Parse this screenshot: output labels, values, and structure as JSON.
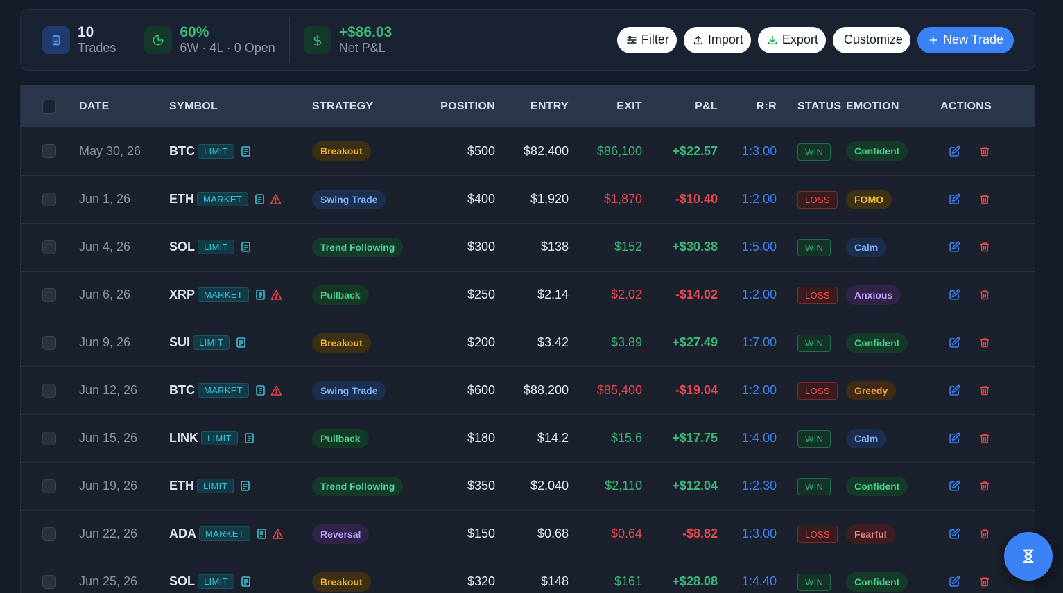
{
  "summary": {
    "trades_value": "10",
    "trades_label": "Trades",
    "winrate_value": "60%",
    "winrate_label": "6W · 4L · 0 Open",
    "pnl_value": "+$86.03",
    "pnl_label": "Net P&L"
  },
  "toolbar": {
    "filter_label": "Filter",
    "import_label": "Import",
    "export_label": "Export",
    "customize_label": "Customize",
    "new_trade_label": "New Trade"
  },
  "colors": {
    "accent": "#3b82f6",
    "profit": "#3ab97a",
    "loss": "#e5484d",
    "background": "#151b27",
    "header_row": "#2a3649"
  },
  "table": {
    "headers": [
      "DATE",
      "SYMBOL",
      "STRATEGY",
      "POSITION",
      "ENTRY",
      "EXIT",
      "P&L",
      "R:R",
      "STATUS",
      "EMOTION",
      "ACTIONS"
    ],
    "rows": [
      {
        "date": "May 30, 26",
        "symbol": "BTC",
        "order_type": "LIMIT",
        "warning": false,
        "strategy": "Breakout",
        "position": "$500",
        "entry": "$82,400",
        "exit": "$86,100",
        "pnl": "+$22.57",
        "rr": "1:3.00",
        "status": "WIN",
        "emotion": "Confident"
      },
      {
        "date": "Jun 1, 26",
        "symbol": "ETH",
        "order_type": "MARKET",
        "warning": true,
        "strategy": "Swing Trade",
        "position": "$400",
        "entry": "$1,920",
        "exit": "$1,870",
        "pnl": "-$10.40",
        "rr": "1:2.00",
        "status": "LOSS",
        "emotion": "FOMO"
      },
      {
        "date": "Jun 4, 26",
        "symbol": "SOL",
        "order_type": "LIMIT",
        "warning": false,
        "strategy": "Trend Following",
        "position": "$300",
        "entry": "$138",
        "exit": "$152",
        "pnl": "+$30.38",
        "rr": "1:5.00",
        "status": "WIN",
        "emotion": "Calm"
      },
      {
        "date": "Jun 6, 26",
        "symbol": "XRP",
        "order_type": "MARKET",
        "warning": true,
        "strategy": "Pullback",
        "position": "$250",
        "entry": "$2.14",
        "exit": "$2.02",
        "pnl": "-$14.02",
        "rr": "1:2.00",
        "status": "LOSS",
        "emotion": "Anxious"
      },
      {
        "date": "Jun 9, 26",
        "symbol": "SUI",
        "order_type": "LIMIT",
        "warning": false,
        "strategy": "Breakout",
        "position": "$200",
        "entry": "$3.42",
        "exit": "$3.89",
        "pnl": "+$27.49",
        "rr": "1:7.00",
        "status": "WIN",
        "emotion": "Confident"
      },
      {
        "date": "Jun 12, 26",
        "symbol": "BTC",
        "order_type": "MARKET",
        "warning": true,
        "strategy": "Swing Trade",
        "position": "$600",
        "entry": "$88,200",
        "exit": "$85,400",
        "pnl": "-$19.04",
        "rr": "1:2.00",
        "status": "LOSS",
        "emotion": "Greedy"
      },
      {
        "date": "Jun 15, 26",
        "symbol": "LINK",
        "order_type": "LIMIT",
        "warning": false,
        "strategy": "Pullback",
        "position": "$180",
        "entry": "$14.2",
        "exit": "$15.6",
        "pnl": "+$17.75",
        "rr": "1:4.00",
        "status": "WIN",
        "emotion": "Calm"
      },
      {
        "date": "Jun 19, 26",
        "symbol": "ETH",
        "order_type": "LIMIT",
        "warning": false,
        "strategy": "Trend Following",
        "position": "$350",
        "entry": "$2,040",
        "exit": "$2,110",
        "pnl": "+$12.04",
        "rr": "1:2.30",
        "status": "WIN",
        "emotion": "Confident"
      },
      {
        "date": "Jun 22, 26",
        "symbol": "ADA",
        "order_type": "MARKET",
        "warning": true,
        "strategy": "Reversal",
        "position": "$150",
        "entry": "$0.68",
        "exit": "$0.64",
        "pnl": "-$8.82",
        "rr": "1:3.00",
        "status": "LOSS",
        "emotion": "Fearful"
      },
      {
        "date": "Jun 25, 26",
        "symbol": "SOL",
        "order_type": "LIMIT",
        "warning": false,
        "strategy": "Breakout",
        "position": "$320",
        "entry": "$148",
        "exit": "$161",
        "pnl": "+$28.08",
        "rr": "1:4.40",
        "status": "WIN",
        "emotion": "Confident"
      }
    ]
  },
  "strategy_colors": {
    "Breakout": {
      "bg": "#3d2f14",
      "fg": "#f2b233"
    },
    "Swing Trade": {
      "bg": "#1c2f4d",
      "fg": "#7fb0ff"
    },
    "Trend Following": {
      "bg": "#153a2c",
      "fg": "#4fd39a"
    },
    "Pullback": {
      "bg": "#143826",
      "fg": "#4ccf8a"
    },
    "Reversal": {
      "bg": "#2f2347",
      "fg": "#b99aff"
    }
  },
  "emotion_colors": {
    "Confident": {
      "bg": "#153a2a",
      "fg": "#45d08a"
    },
    "FOMO": {
      "bg": "#3f3214",
      "fg": "#f3bf2f"
    },
    "Calm": {
      "bg": "#1b2e4b",
      "fg": "#7fb0ff"
    },
    "Anxious": {
      "bg": "#2f2347",
      "fg": "#c39cff"
    },
    "Greedy": {
      "bg": "#3e2a16",
      "fg": "#f4a24a"
    },
    "Fearful": {
      "bg": "#3d1d22",
      "fg": "#f08080"
    }
  },
  "icons": {
    "trades": "clipboard-icon",
    "winrate": "pie-chart-icon",
    "pnl": "dollar-icon",
    "filter": "sliders-icon",
    "import": "upload-icon",
    "export": "download-icon",
    "new_trade": "plus-icon",
    "notes": "notebook-icon",
    "warning": "warning-icon",
    "edit": "edit-icon",
    "delete": "trash-icon",
    "fab": "hourglass-icon"
  }
}
